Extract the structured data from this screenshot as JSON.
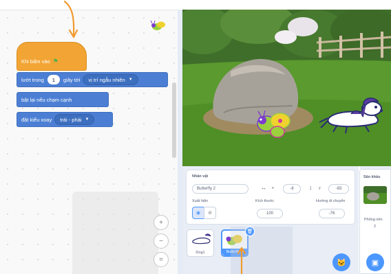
{
  "code_area": {
    "hat_block": {
      "label": "Khi bấm vào"
    },
    "glide_block": {
      "prefix": "lướt trong",
      "seconds": "1",
      "middle": "giây tới",
      "target": "vị trí ngẫu nhiên"
    },
    "bounce_block": {
      "label": "bật lại nếu chạm cạnh"
    },
    "rotation_block": {
      "prefix": "đặt kiểu xoay",
      "style": "trái - phải"
    },
    "zoom": {
      "in": "+",
      "out": "−",
      "reset": "="
    }
  },
  "sprite_info": {
    "sprite_label": "Nhân vật",
    "sprite_name": "Butterfly 2",
    "x_label": "x",
    "x_value": "-8",
    "y_label": "y",
    "y_value": "-93",
    "show_label": "Xuất hiện",
    "size_label": "Kích thước",
    "size_value": "100",
    "direction_label": "Hướng di chuyển",
    "direction_value": "-76"
  },
  "sprites": [
    {
      "name": "Dog1",
      "selected": false
    },
    {
      "name": "Butterfly 2",
      "selected": true
    }
  ],
  "stage_panel": {
    "title": "Sân khấu",
    "backdrops_label": "Phông nền",
    "backdrops_count": "2"
  },
  "colors": {
    "events": "#f2a534",
    "motion": "#4c7fd4",
    "accent": "#4c97ff",
    "annotation_arrow": "#f29a2e"
  }
}
